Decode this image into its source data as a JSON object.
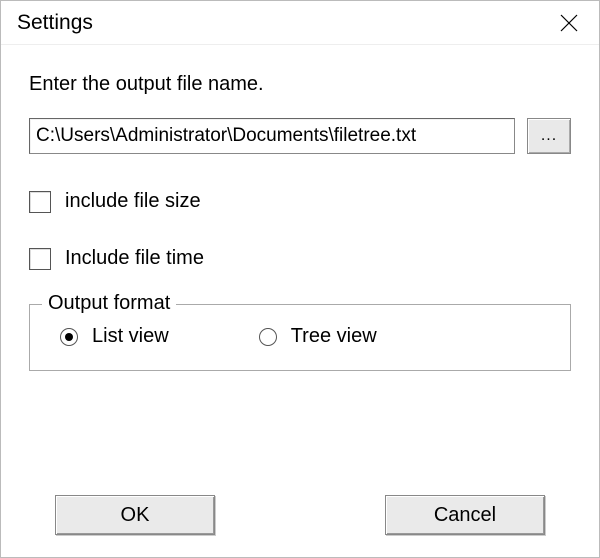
{
  "window": {
    "title": "Settings"
  },
  "prompt": "Enter the output file name.",
  "path_input": {
    "value": "C:\\Users\\Administrator\\Documents\\filetree.txt"
  },
  "browse_label": "...",
  "checkboxes": {
    "include_file_size": {
      "label": "include file size",
      "checked": false
    },
    "include_file_time": {
      "label": "Include file time",
      "checked": false
    }
  },
  "output_format": {
    "legend": "Output format",
    "options": {
      "list_view": {
        "label": "List view",
        "selected": true
      },
      "tree_view": {
        "label": "Tree view",
        "selected": false
      }
    }
  },
  "buttons": {
    "ok": "OK",
    "cancel": "Cancel"
  }
}
